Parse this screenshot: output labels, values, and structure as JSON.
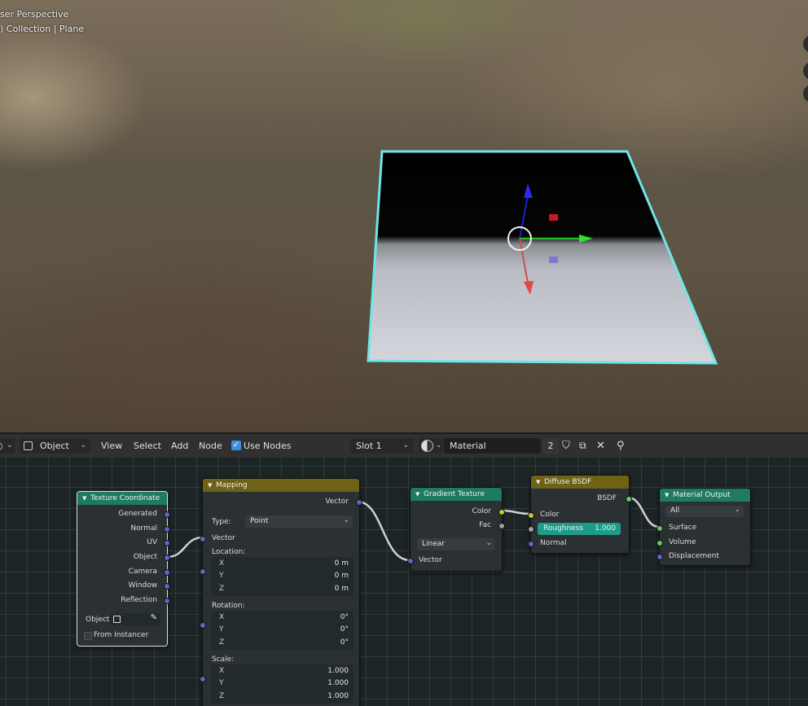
{
  "viewport": {
    "title": "ser Perspective",
    "collection": ") Collection | Plane"
  },
  "header": {
    "mode_label": "Object",
    "menu": [
      "View",
      "Select",
      "Add",
      "Node"
    ],
    "use_nodes_label": "Use Nodes",
    "use_nodes_checked": true,
    "slot_label": "Slot 1",
    "material_name": "Material",
    "user_count": "2"
  },
  "nodes": {
    "texture_coordinate": {
      "title": "Texture Coordinate",
      "outputs": [
        "Generated",
        "Normal",
        "UV",
        "Object",
        "Camera",
        "Window",
        "Reflection"
      ],
      "object_label": "Object:",
      "from_instancer_label": "From Instancer"
    },
    "mapping": {
      "title": "Mapping",
      "output_label": "Vector",
      "type_label": "Type:",
      "type_value": "Point",
      "input_vector_label": "Vector",
      "location_label": "Location:",
      "location": [
        "0 m",
        "0 m",
        "0 m"
      ],
      "rotation_label": "Rotation:",
      "rotation": [
        "0°",
        "0°",
        "0°"
      ],
      "scale_label": "Scale:",
      "scale": [
        "1.000",
        "1.000",
        "1.000"
      ],
      "axes": [
        "X",
        "Y",
        "Z"
      ]
    },
    "gradient_texture": {
      "title": "Gradient Texture",
      "outputs": [
        "Color",
        "Fac"
      ],
      "type_value": "Linear",
      "input_vector_label": "Vector"
    },
    "diffuse_bsdf": {
      "title": "Diffuse BSDF",
      "output_label": "BSDF",
      "color_label": "Color",
      "roughness_label": "Roughness",
      "roughness_value": "1.000",
      "roughness_fraction": 1.0,
      "normal_label": "Normal"
    },
    "material_output": {
      "title": "Material Output",
      "target_value": "All",
      "inputs": [
        "Surface",
        "Volume",
        "Displacement"
      ]
    }
  },
  "colors": {
    "shader_header": "#1e7a62",
    "vector_header": "#6e6217",
    "socket_vector": "#6363c7",
    "socket_color": "#c7c729",
    "socket_float": "#a1a1a1",
    "socket_shader": "#63c763",
    "plane_outline": "#6ee6e6",
    "roughness_fill": "#1d9c8a"
  }
}
